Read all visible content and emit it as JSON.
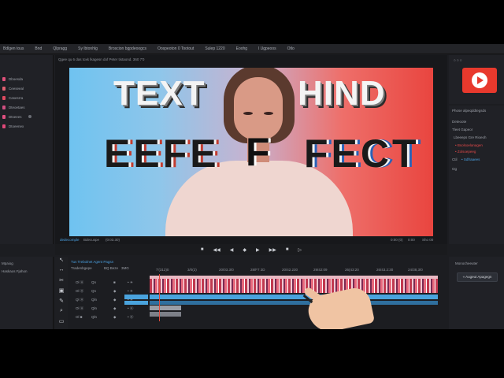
{
  "menu": [
    "Bdlgen tous",
    "Bnd",
    "Qlpragg",
    "Sy lbtonhlg",
    "Broscion bgpdeoogcs",
    "Oospeoton 0 Tootout",
    "Sulep 1220",
    "Eoohg",
    "l Ugpeoos",
    "Otlo"
  ],
  "left_panel": {
    "items": [
      {
        "label": "Dboesda",
        "color": "#e0507a"
      },
      {
        "label": "Ceeseeal",
        "color": "#e06070"
      },
      {
        "label": "Casesrra",
        "color": "#e04a60"
      },
      {
        "label": "Dteoetaes",
        "color": "#d05080"
      },
      {
        "label": "Dtseees",
        "color": "#e05080"
      },
      {
        "label": "Dtoeenex",
        "color": "#e04878"
      }
    ]
  },
  "viewer": {
    "info": "Qgee qu 6 das toxk lkagesn dof Peter tistaond. 360 7'0",
    "preview_text": {
      "line1_left": "TEXT",
      "line1_right": "HIND",
      "line2_left": "EEFE",
      "line2_mid": "F",
      "line2_right": "FECT"
    },
    "bar_left": "dedecomple",
    "bar_mid": "Bdecuspe",
    "bar_time": "(0:03.30)",
    "bar_r1": "0:00 (0)",
    "bar_r2": "0:00",
    "bar_r3": "Sho 00"
  },
  "right_panel": {
    "header_dots": "○ ○ ○",
    "section_title": "Phose alpeqddtegsds",
    "label1": "Deteoote",
    "label2": "Tleet Gapeor",
    "label3": "Lbeeeps Gre Rioeoh",
    "red1": "• Bsolsoelanagen",
    "red2": "• Zolsoepeeg",
    "label4": "Ctil",
    "blue1": "• Sdfraaees",
    "label5": "Og",
    "bottom_title": "Monocheeuter",
    "bottom_button": "« Augeut Apagegn"
  },
  "transport": [
    "■",
    "◀◀",
    "◀",
    "◆",
    "▶",
    "▶▶",
    "■",
    "▷"
  ],
  "bottom_left": {
    "label1": "Mpaiog",
    "label2": "Haskaos Fjahon"
  },
  "tools": [
    "↖",
    "↔",
    "✂",
    "▣",
    "✎",
    "⌕",
    "▭",
    "☰"
  ],
  "timeline": {
    "seq_name": "Tus Trebolnet Agent Pagsn",
    "seq_sub1": "Tradenbgepe",
    "seq_sub2": "BQ Beze",
    "seq_sub3": "3MG",
    "ticks": [
      "7'(312)0",
      "3/0(2)",
      "20/03.3/0",
      "28/F7 2D",
      "20/42.230",
      "29/42:09",
      "26(43:20",
      "26/43.2:30",
      "24/38,3/0"
    ],
    "tracks": [
      {
        "a": "Ol Ⓐ",
        "b": "Qn",
        "c": "■",
        "d": "• ☀"
      },
      {
        "a": "Ol Ⓐ",
        "b": "Qn",
        "c": "◆",
        "d": "• ☀"
      },
      {
        "a": "Ql Ⓐ",
        "b": "Qln",
        "c": "◆",
        "d": "• ☀"
      },
      {
        "a": "Ol Ⓐ",
        "b": "Qln",
        "c": "◆",
        "d": "• Ⓐ"
      },
      {
        "a": "Ol ■",
        "b": "Qln",
        "c": "◆",
        "d": "• Ⓐ"
      }
    ]
  }
}
